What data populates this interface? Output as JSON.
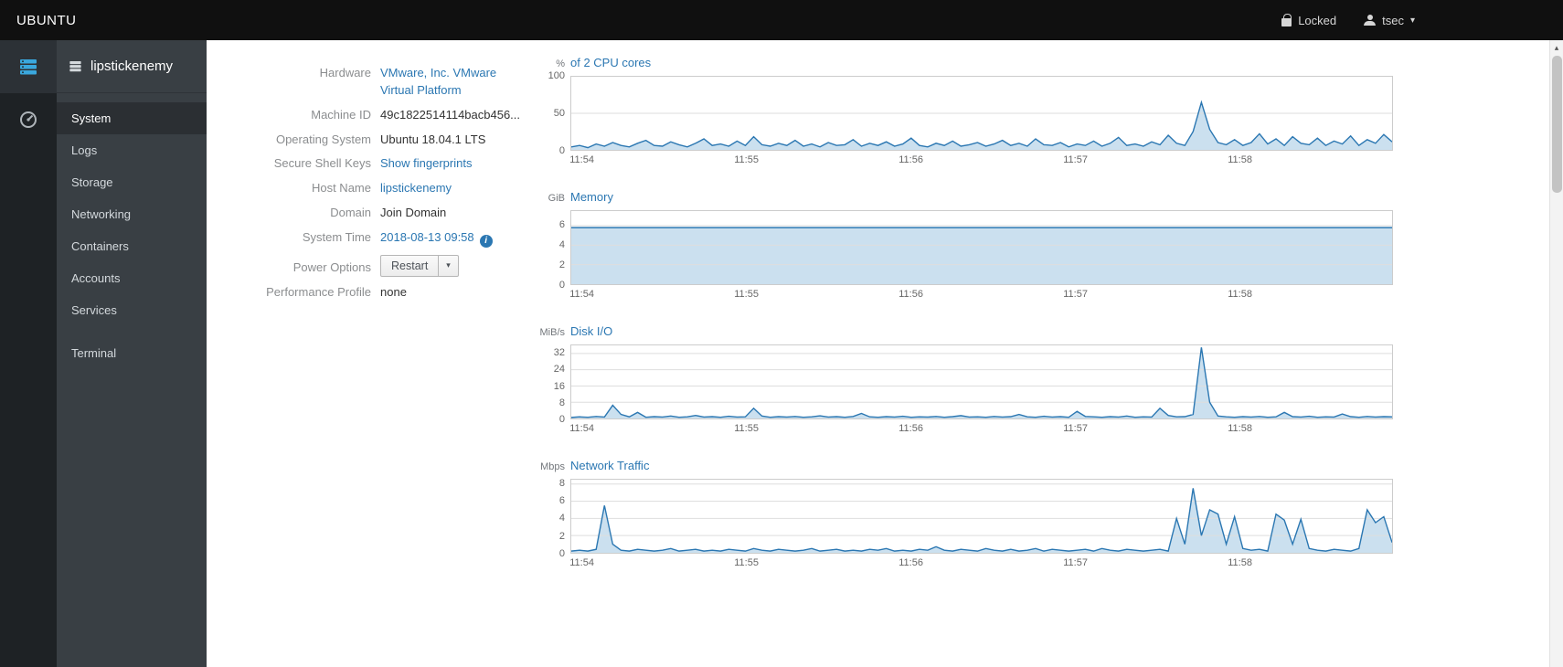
{
  "topbar": {
    "brand": "UBUNTU",
    "locked_label": "Locked",
    "user_label": "tsec"
  },
  "sidebar": {
    "host_name": "lipstickenemy",
    "items": [
      {
        "label": "System",
        "active": true
      },
      {
        "label": "Logs",
        "active": false
      },
      {
        "label": "Storage",
        "active": false
      },
      {
        "label": "Networking",
        "active": false
      },
      {
        "label": "Containers",
        "active": false
      },
      {
        "label": "Accounts",
        "active": false
      },
      {
        "label": "Services",
        "active": false
      },
      {
        "label": "Terminal",
        "active": false
      }
    ]
  },
  "system_info": {
    "rows": [
      {
        "label": "Hardware",
        "value": "VMware, Inc. VMware Virtual Platform"
      },
      {
        "label": "Machine ID",
        "value": "49c1822514114bacb456..."
      },
      {
        "label": "Operating System",
        "value": "Ubuntu 18.04.1 LTS"
      },
      {
        "label": "Secure Shell Keys",
        "value": "Show fingerprints"
      },
      {
        "label": "Host Name",
        "value": "lipstickenemy"
      },
      {
        "label": "Domain",
        "value": "Join Domain"
      },
      {
        "label": "System Time",
        "value": "2018-08-13 09:58"
      },
      {
        "label": "Power Options",
        "value": "Restart"
      },
      {
        "label": "Performance Profile",
        "value": "none"
      }
    ]
  },
  "icons": {
    "caret_down": "▾",
    "scroll_up": "▴",
    "info": "i"
  },
  "colors": {
    "link": "#2b77b2",
    "chart_line": "#2b77b2",
    "chart_fill": "#a9cbe5",
    "sidebar_icon_blue": "#3aa7dd"
  },
  "chart_data": [
    {
      "type": "area",
      "unit": "%",
      "title": "of 2 CPU cores",
      "x_ticks": [
        "11:54",
        "11:55",
        "11:56",
        "11:57",
        "11:58"
      ],
      "x_tick_fracs": [
        0.014,
        0.214,
        0.414,
        0.614,
        0.814
      ],
      "ylim": [
        0,
        100
      ],
      "y_ticks": [
        0,
        50,
        100
      ],
      "values": [
        4,
        6,
        3,
        8,
        5,
        10,
        6,
        4,
        9,
        13,
        6,
        5,
        11,
        7,
        4,
        9,
        15,
        6,
        8,
        5,
        12,
        6,
        18,
        7,
        5,
        9,
        6,
        13,
        5,
        8,
        4,
        10,
        6,
        7,
        14,
        5,
        9,
        6,
        11,
        5,
        8,
        16,
        6,
        4,
        9,
        6,
        12,
        5,
        7,
        10,
        5,
        8,
        13,
        6,
        9,
        5,
        15,
        7,
        6,
        10,
        4,
        8,
        6,
        12,
        5,
        9,
        17,
        6,
        8,
        5,
        11,
        7,
        20,
        9,
        6,
        25,
        65,
        28,
        10,
        7,
        14,
        6,
        10,
        22,
        8,
        15,
        6,
        18,
        9,
        7,
        16,
        6,
        12,
        8,
        19,
        6,
        14,
        9,
        21,
        11
      ]
    },
    {
      "type": "area",
      "unit": "GiB",
      "title": "Memory",
      "x_ticks": [
        "11:54",
        "11:55",
        "11:56",
        "11:57",
        "11:58"
      ],
      "x_tick_fracs": [
        0.014,
        0.214,
        0.414,
        0.614,
        0.814
      ],
      "ylim": [
        0,
        7.5
      ],
      "y_ticks": [
        0,
        2,
        4,
        6
      ],
      "values": [
        5.8,
        5.8,
        5.8,
        5.8,
        5.8,
        5.8,
        5.8,
        5.8,
        5.8,
        5.8,
        5.8,
        5.8,
        5.8,
        5.8,
        5.8,
        5.8,
        5.8,
        5.8,
        5.8,
        5.8
      ]
    },
    {
      "type": "area",
      "unit": "MiB/s",
      "title": "Disk I/O",
      "x_ticks": [
        "11:54",
        "11:55",
        "11:56",
        "11:57",
        "11:58"
      ],
      "x_tick_fracs": [
        0.014,
        0.214,
        0.414,
        0.614,
        0.814
      ],
      "ylim": [
        0,
        36
      ],
      "y_ticks": [
        0,
        8,
        16,
        24,
        32
      ],
      "values": [
        0.5,
        0.8,
        0.6,
        1.0,
        0.7,
        6.5,
        2.0,
        0.8,
        3.0,
        0.6,
        0.9,
        0.7,
        1.2,
        0.6,
        0.8,
        1.5,
        0.7,
        0.9,
        0.6,
        1.1,
        0.7,
        0.8,
        5.0,
        1.2,
        0.6,
        0.9,
        0.7,
        1.0,
        0.6,
        0.8,
        1.3,
        0.7,
        0.9,
        0.6,
        1.0,
        2.5,
        0.8,
        0.6,
        0.9,
        0.7,
        1.1,
        0.6,
        0.8,
        0.7,
        1.0,
        0.6,
        0.9,
        1.4,
        0.7,
        0.8,
        0.6,
        1.0,
        0.7,
        0.9,
        2.0,
        0.8,
        0.6,
        1.1,
        0.7,
        0.9,
        0.6,
        3.5,
        1.0,
        0.8,
        0.6,
        0.9,
        0.7,
        1.2,
        0.6,
        0.8,
        0.7,
        5.0,
        1.5,
        0.8,
        0.9,
        2.0,
        35.0,
        8.0,
        1.2,
        0.8,
        0.6,
        0.9,
        0.7,
        1.0,
        0.6,
        0.8,
        3.0,
        0.9,
        0.7,
        1.1,
        0.6,
        0.8,
        0.7,
        2.2,
        0.9,
        0.6,
        1.0,
        0.7,
        0.9,
        0.8
      ]
    },
    {
      "type": "area",
      "unit": "Mbps",
      "title": "Network Traffic",
      "x_ticks": [
        "11:54",
        "11:55",
        "11:56",
        "11:57",
        "11:58"
      ],
      "x_tick_fracs": [
        0.014,
        0.214,
        0.414,
        0.614,
        0.814
      ],
      "ylim": [
        0,
        8.5
      ],
      "y_ticks": [
        0,
        2,
        4,
        6,
        8
      ],
      "values": [
        0.2,
        0.3,
        0.2,
        0.4,
        5.5,
        1.0,
        0.3,
        0.2,
        0.4,
        0.3,
        0.2,
        0.3,
        0.5,
        0.2,
        0.3,
        0.4,
        0.2,
        0.3,
        0.2,
        0.4,
        0.3,
        0.2,
        0.5,
        0.3,
        0.2,
        0.4,
        0.3,
        0.2,
        0.3,
        0.5,
        0.2,
        0.3,
        0.4,
        0.2,
        0.3,
        0.2,
        0.4,
        0.3,
        0.5,
        0.2,
        0.3,
        0.2,
        0.4,
        0.3,
        0.7,
        0.3,
        0.2,
        0.4,
        0.3,
        0.2,
        0.5,
        0.3,
        0.2,
        0.4,
        0.2,
        0.3,
        0.5,
        0.2,
        0.4,
        0.3,
        0.2,
        0.3,
        0.4,
        0.2,
        0.5,
        0.3,
        0.2,
        0.4,
        0.3,
        0.2,
        0.3,
        0.4,
        0.2,
        4.0,
        1.0,
        7.5,
        2.0,
        5.0,
        4.5,
        1.0,
        4.2,
        0.5,
        0.3,
        0.4,
        0.2,
        4.5,
        3.8,
        1.0,
        3.9,
        0.5,
        0.3,
        0.2,
        0.4,
        0.3,
        0.2,
        0.5,
        5.0,
        3.5,
        4.2,
        1.2
      ]
    }
  ]
}
